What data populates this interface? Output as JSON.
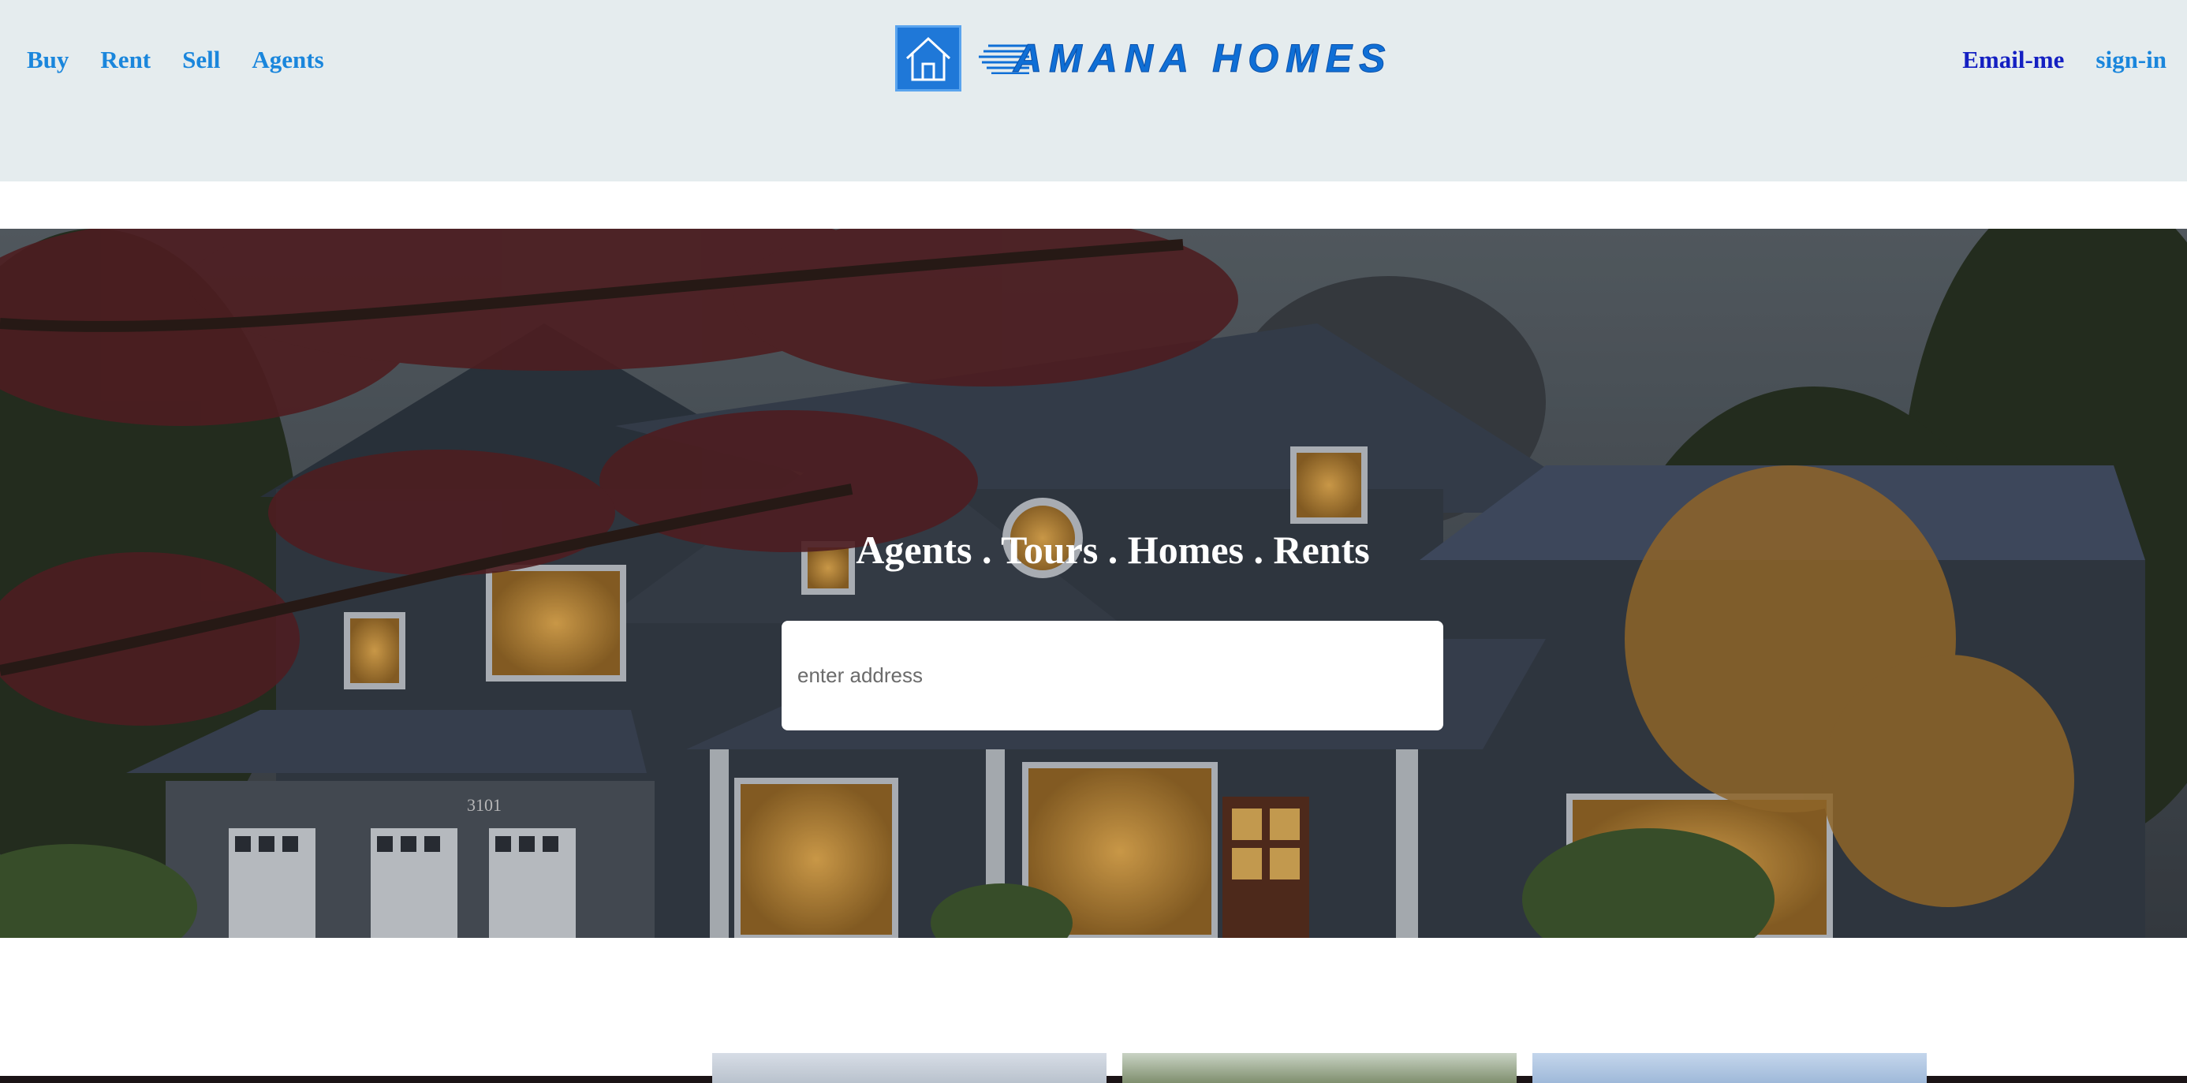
{
  "header": {
    "nav_left": [
      "Buy",
      "Rent",
      "Sell",
      "Agents"
    ],
    "nav_right": [
      "Email-me",
      "sign-in"
    ],
    "logo_text": "AMANA HOMES",
    "logo_icon": "house-icon"
  },
  "hero": {
    "tagline": "Agents . Tours . Homes . Rents",
    "search_placeholder": "enter address",
    "house_number": "3101"
  },
  "colors": {
    "header_bg": "#e5ecee",
    "nav_link": "#1a86dc",
    "nav_link_dark": "#1420c2",
    "logo_blue": "#1f78d8"
  }
}
